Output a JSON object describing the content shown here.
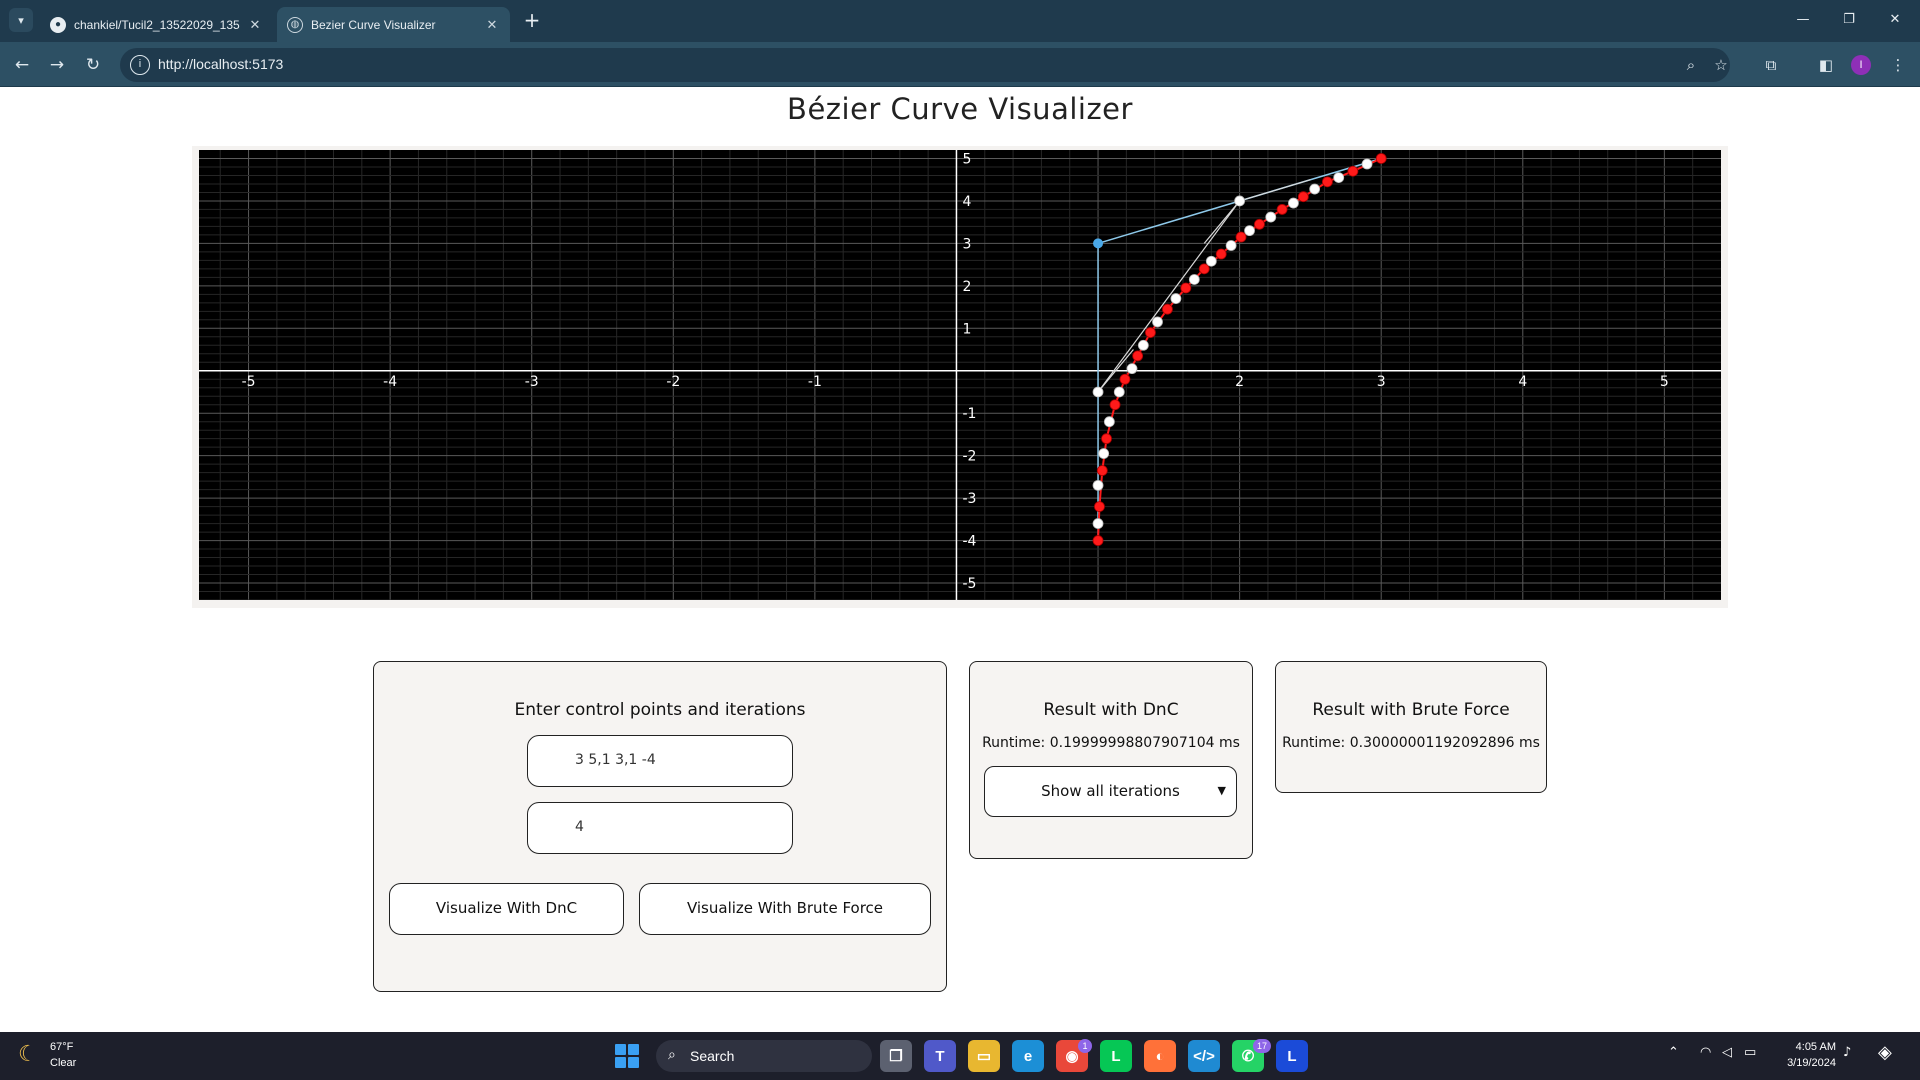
{
  "browser": {
    "tabs": [
      {
        "label": "chankiel/Tucil2_13522029_135…",
        "icon": "github-icon"
      },
      {
        "label": "Bezier Curve Visualizer",
        "icon": "globe-icon"
      }
    ],
    "url": "http://localhost:5173",
    "profile_initial": "I"
  },
  "page": {
    "title": "Bézier Curve Visualizer"
  },
  "chart_data": {
    "type": "scatter",
    "title": "",
    "xlim": [
      -5.35,
      5.4
    ],
    "ylim": [
      -5.4,
      5.2
    ],
    "x_ticks": [
      -5,
      -4,
      -3,
      -2,
      -1,
      2,
      3,
      4,
      5
    ],
    "y_ticks": [
      5,
      4,
      3,
      2,
      1,
      -1,
      -2,
      -3,
      -4,
      -5
    ],
    "grid": true,
    "background": "#000000",
    "control_points": [
      [
        3,
        5
      ],
      [
        1,
        3
      ],
      [
        1,
        -4
      ]
    ],
    "control_polygon_color": "#8ec9ea",
    "series": [
      {
        "name": "",
        "color": "#ff1a1a",
        "points": [
          [
            1.0,
            -4.0
          ],
          [
            1.01,
            -3.2
          ],
          [
            1.03,
            -2.35
          ],
          [
            1.06,
            -1.6
          ],
          [
            1.12,
            -0.8
          ],
          [
            1.19,
            -0.2
          ],
          [
            1.28,
            0.35
          ],
          [
            1.37,
            0.9
          ],
          [
            1.49,
            1.45
          ],
          [
            1.62,
            1.95
          ],
          [
            1.75,
            2.4
          ],
          [
            1.87,
            2.75
          ],
          [
            2.01,
            3.15
          ],
          [
            2.14,
            3.45
          ],
          [
            2.3,
            3.8
          ],
          [
            2.45,
            4.1
          ],
          [
            2.62,
            4.45
          ],
          [
            2.8,
            4.7
          ],
          [
            3.0,
            5.0
          ]
        ]
      },
      {
        "name": "",
        "color": "#ffffff",
        "points": [
          [
            1.0,
            -3.6
          ],
          [
            1.0,
            -2.7
          ],
          [
            1.04,
            -1.95
          ],
          [
            1.08,
            -1.2
          ],
          [
            1.15,
            -0.5
          ],
          [
            1.24,
            0.05
          ],
          [
            1.32,
            0.6
          ],
          [
            1.42,
            1.15
          ],
          [
            1.55,
            1.7
          ],
          [
            1.68,
            2.15
          ],
          [
            1.8,
            2.58
          ],
          [
            1.94,
            2.95
          ],
          [
            2.07,
            3.3
          ],
          [
            2.22,
            3.62
          ],
          [
            2.38,
            3.95
          ],
          [
            2.53,
            4.28
          ],
          [
            2.7,
            4.55
          ],
          [
            2.9,
            4.87
          ],
          [
            1.0,
            -0.5
          ],
          [
            2.0,
            4.0
          ]
        ]
      }
    ],
    "highlight_point": [
      1,
      3
    ],
    "highlight_color": "#4aa8e8",
    "construction_lines": [
      [
        [
          1,
          -0.5
        ],
        [
          2,
          4
        ]
      ],
      [
        [
          2,
          4
        ],
        [
          2.5,
          4.5
        ]
      ],
      [
        [
          1,
          -0.5
        ],
        [
          1.25,
          0.5
        ]
      ],
      [
        [
          2,
          4
        ],
        [
          1.75,
          3.0
        ]
      ]
    ]
  },
  "input_panel": {
    "title": "Enter control points and iterations",
    "points_value": "3 5,1 3,1 -4",
    "iterations_value": "4",
    "dnc_button": "Visualize With DnC",
    "brute_button": "Visualize With Brute Force"
  },
  "dnc_panel": {
    "title": "Result with DnC",
    "runtime_label": "Runtime: ",
    "runtime_value": "0.19999998807907104 ms",
    "select_value": "Show all iterations"
  },
  "brute_panel": {
    "title": "Result with Brute Force",
    "runtime_label": "Runtime: ",
    "runtime_value": "0.30000001192092896 ms"
  },
  "taskbar": {
    "weather_temp": "67°F",
    "weather_desc": "Clear",
    "search_label": "Search",
    "chrome_badge": "1",
    "whatsapp_badge": "17",
    "time": "4:05 AM",
    "date": "3/19/2024"
  }
}
